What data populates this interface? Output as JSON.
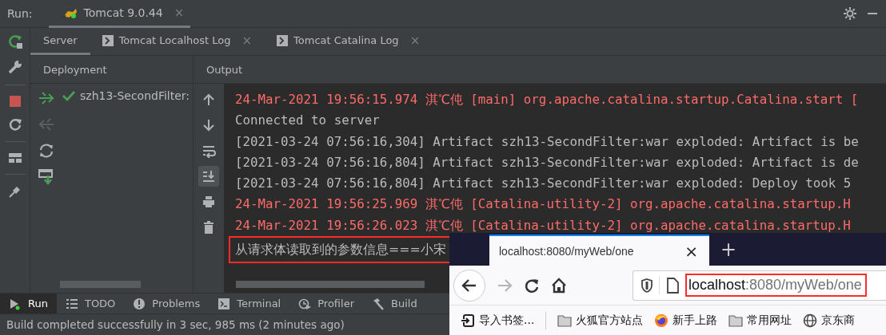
{
  "run_bar": {
    "label": "Run:",
    "tabs": [
      {
        "label": "Tomcat 9.0.44",
        "selected": true,
        "close": "×"
      }
    ]
  },
  "service_tabs": [
    {
      "label": "Server",
      "selected": true,
      "kind": "server"
    },
    {
      "label": "Tomcat Localhost Log",
      "selected": false,
      "kind": "log",
      "close": "×"
    },
    {
      "label": "Tomcat Catalina Log",
      "selected": false,
      "kind": "log",
      "close": "×"
    }
  ],
  "deployment": {
    "header": "Deployment",
    "items": [
      {
        "label": "szh13-SecondFilter:",
        "deployed": true
      }
    ]
  },
  "output": {
    "header": "Output",
    "tools": [
      {
        "kind": "up",
        "selected": false
      },
      {
        "kind": "down",
        "selected": false
      },
      {
        "kind": "wrap",
        "selected": false
      },
      {
        "kind": "scroll-end",
        "selected": true
      },
      {
        "kind": "print",
        "selected": false
      },
      {
        "kind": "clear",
        "selected": false
      }
    ],
    "lines": [
      {
        "kind": "error",
        "text": "24-Mar-2021 19:56:15.974 淇℃伅 [main] org.apache.catalina.startup.Catalina.start [",
        "annotated": false
      },
      {
        "kind": "info",
        "text": "Connected to server",
        "annotated": false
      },
      {
        "kind": "info",
        "text": "[2021-03-24 07:56:16,304] Artifact szh13-SecondFilter:war exploded: Artifact is be",
        "annotated": false
      },
      {
        "kind": "info",
        "text": "[2021-03-24 07:56:16,804] Artifact szh13-SecondFilter:war exploded: Artifact is de",
        "annotated": false
      },
      {
        "kind": "info",
        "text": "[2021-03-24 07:56:16,804] Artifact szh13-SecondFilter:war exploded: Deploy took 5",
        "annotated": false
      },
      {
        "kind": "error",
        "text": "24-Mar-2021 19:56:25.969 淇℃伅 [Catalina-utility-2] org.apache.catalina.startup.H",
        "annotated": false
      },
      {
        "kind": "error",
        "text": "24-Mar-2021 19:56:26.023 淇℃伅 [Catalina-utility-2] org.apache.catalina.startup.H",
        "annotated": false
      },
      {
        "kind": "info",
        "text": "从请求体读取到的参数信息===小宋",
        "annotated": true
      }
    ]
  },
  "tool_windows": [
    {
      "label": "Run",
      "kind": "run",
      "selected": true
    },
    {
      "label": "TODO",
      "kind": "todo",
      "selected": false
    },
    {
      "label": "Problems",
      "kind": "problems",
      "selected": false
    },
    {
      "label": "Terminal",
      "kind": "terminal",
      "selected": false
    },
    {
      "label": "Profiler",
      "kind": "profiler",
      "selected": false
    },
    {
      "label": "Build",
      "kind": "build",
      "selected": false
    }
  ],
  "status_bar": "Build completed successfully in 3 sec, 985 ms (2 minutes ago)",
  "browser": {
    "tab": {
      "title": "localhost:8080/myWeb/one",
      "close": "×"
    },
    "new_tab": "+",
    "forward_disabled": true,
    "url": {
      "host": "localhost",
      "path": ":8080/myWeb/one",
      "annotated": true
    },
    "bookmarks": [
      {
        "kind": "import",
        "label": "导入书签..."
      },
      {
        "kind": "folder",
        "label": "火狐官方站点"
      },
      {
        "kind": "firefox",
        "label": "新手上路"
      },
      {
        "kind": "folder",
        "label": "常用网址"
      },
      {
        "kind": "globe",
        "label": "京东商"
      }
    ]
  }
}
